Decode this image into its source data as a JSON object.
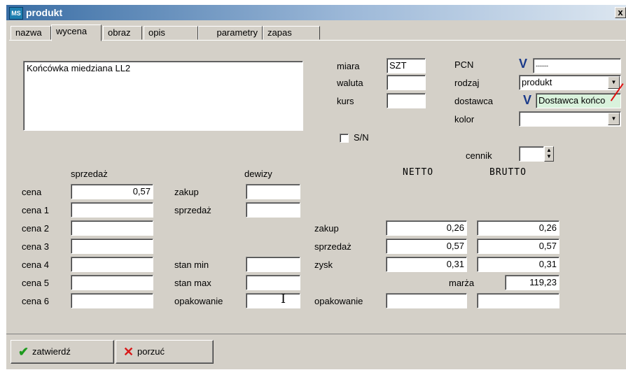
{
  "window": {
    "title": "produkt",
    "icon": "MS",
    "close_label": "x"
  },
  "tabs": [
    "nazwa",
    "wycena",
    "obraz",
    "opis",
    "parametry",
    "zapas"
  ],
  "description": "Końcówka miedziana LL2",
  "right_panel": {
    "miara_label": "miara",
    "miara_value": "SZT",
    "waluta_label": "waluta",
    "waluta_value": "",
    "kurs_label": "kurs",
    "kurs_value": "",
    "sn_label": "S/N",
    "pcn_label": "PCN",
    "pcn_value": "------",
    "rodzaj_label": "rodzaj",
    "rodzaj_value": "produkt",
    "dostawca_label": "dostawca",
    "dostawca_value": "Dostawca końco",
    "kolor_label": "kolor",
    "kolor_value": "",
    "cennik_label": "cennik",
    "cennik_value": ""
  },
  "left_prices": {
    "header_sprzedaz": "sprzedaż",
    "rows": [
      {
        "label": "cena",
        "value": "0,57"
      },
      {
        "label": "cena 1",
        "value": ""
      },
      {
        "label": "cena 2",
        "value": ""
      },
      {
        "label": "cena 3",
        "value": ""
      },
      {
        "label": "cena 4",
        "value": ""
      },
      {
        "label": "cena 5",
        "value": ""
      },
      {
        "label": "cena 6",
        "value": ""
      }
    ]
  },
  "middle": {
    "header_dewizy": "dewizy",
    "zakup_label": "zakup",
    "zakup_value": "",
    "sprzedaz_label": "sprzedaż",
    "sprzedaz_value": "",
    "stan_min_label": "stan min",
    "stan_min_value": "",
    "stan_max_label": "stan max",
    "stan_max_value": "",
    "opakowanie_label": "opakowanie",
    "opakowanie_value": ""
  },
  "netto_brutto": {
    "netto_header": "NETTO",
    "brutto_header": "BRUTTO",
    "rows": [
      {
        "label": "zakup",
        "netto": "0,26",
        "brutto": "0,26"
      },
      {
        "label": "sprzedaż",
        "netto": "0,57",
        "brutto": "0,57"
      },
      {
        "label": "zysk",
        "netto": "0,31",
        "brutto": "0,31"
      }
    ],
    "marza_label": "marża",
    "marza_value": "119,23",
    "opakowanie_label": "opakowanie",
    "opakowanie_netto": "",
    "opakowanie_brutto": ""
  },
  "buttons": {
    "confirm_label": "zatwierdź",
    "cancel_label": "porzuć"
  }
}
